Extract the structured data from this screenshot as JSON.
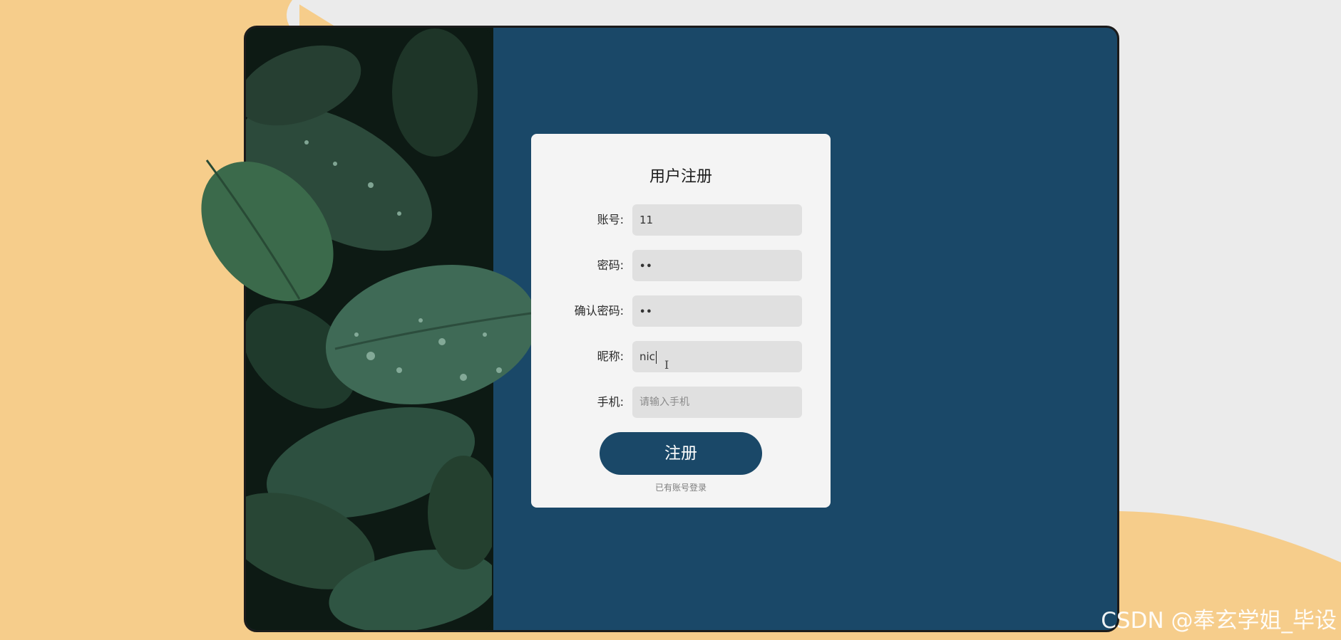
{
  "form": {
    "title": "用户注册",
    "fields": [
      {
        "label": "账号:",
        "value": "11",
        "placeholder": ""
      },
      {
        "label": "密码:",
        "value": "••",
        "placeholder": ""
      },
      {
        "label": "确认密码:",
        "value": "••",
        "placeholder": ""
      },
      {
        "label": "昵称:",
        "value": "nic",
        "placeholder": ""
      },
      {
        "label": "手机:",
        "value": "",
        "placeholder": "请输入手机"
      }
    ],
    "submit_label": "注册",
    "login_link": "已有账号登录"
  },
  "watermark": "CSDN @奉玄学姐_毕设",
  "colors": {
    "background": "#f6cd8b",
    "panel": "#1a4868",
    "card": "#f4f4f4",
    "input": "#e0e0e0",
    "button": "#1a4868"
  },
  "icons": {
    "cursor": "text-ibeam-cursor"
  }
}
